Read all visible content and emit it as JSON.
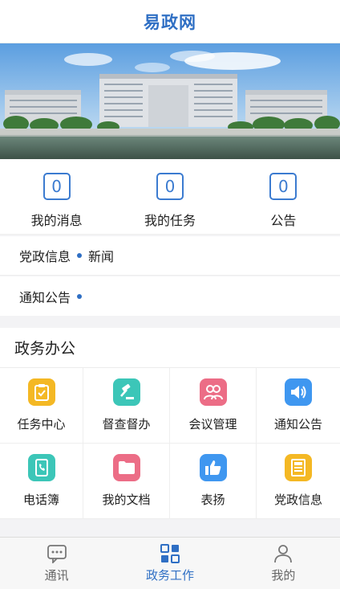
{
  "header": {
    "title": "易政网"
  },
  "stats": [
    {
      "value": "0",
      "label": "我的消息"
    },
    {
      "value": "0",
      "label": "我的任务"
    },
    {
      "value": "0",
      "label": "公告"
    }
  ],
  "news": [
    {
      "label": "党政信息",
      "text": "新闻"
    },
    {
      "label": "通知公告",
      "text": ""
    }
  ],
  "office": {
    "title": "政务办公",
    "items": [
      {
        "label": "任务中心",
        "icon": "task-clipboard-icon",
        "color": "#f4b824"
      },
      {
        "label": "督查督办",
        "icon": "gavel-icon",
        "color": "#3cc6b8"
      },
      {
        "label": "会议管理",
        "icon": "meeting-people-icon",
        "color": "#ec6d86"
      },
      {
        "label": "通知公告",
        "icon": "speaker-icon",
        "color": "#3f97f0"
      },
      {
        "label": "电话簿",
        "icon": "phone-book-icon",
        "color": "#3cc6b8"
      },
      {
        "label": "我的文档",
        "icon": "folder-icon",
        "color": "#ec6d86"
      },
      {
        "label": "表扬",
        "icon": "thumbs-up-icon",
        "color": "#3f97f0"
      },
      {
        "label": "党政信息",
        "icon": "news-document-icon",
        "color": "#f4b824"
      }
    ]
  },
  "tabbar": {
    "items": [
      {
        "label": "通讯",
        "icon": "chat-bubble-icon",
        "active": false
      },
      {
        "label": "政务工作",
        "icon": "grid-apps-icon",
        "active": true
      },
      {
        "label": "我的",
        "icon": "person-icon",
        "active": false
      }
    ]
  },
  "colors": {
    "accent": "#2f6fc4"
  }
}
